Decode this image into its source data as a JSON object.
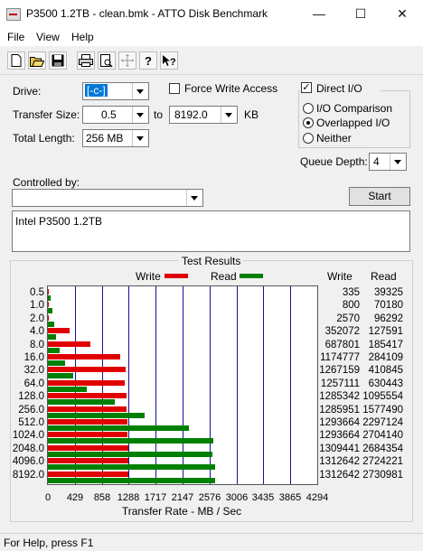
{
  "window": {
    "title": "P3500 1.2TB - clean.bmk - ATTO Disk Benchmark",
    "minimize": "—",
    "maximize": "☐",
    "close": "✕"
  },
  "menu": {
    "file": "File",
    "view": "View",
    "help": "Help"
  },
  "toolbar": {
    "buttons": [
      "new-icon",
      "open-icon",
      "save-icon",
      "print-icon",
      "print-preview-icon",
      "move-icon",
      "help-icon",
      "context-help-icon"
    ]
  },
  "settings": {
    "drive_label": "Drive:",
    "drive_value": "[-c-]",
    "force_write_label": "Force Write Access",
    "force_write_checked": false,
    "direct_io_label": "Direct I/O",
    "direct_io_checked": true,
    "transfer_size_label": "Transfer Size:",
    "transfer_from": "0.5",
    "transfer_to_label": "to",
    "transfer_to": "8192.0",
    "transfer_unit": "KB",
    "total_length_label": "Total Length:",
    "total_length": "256 MB",
    "io_comparison_label": "I/O Comparison",
    "overlapped_io_label": "Overlapped I/O",
    "neither_label": "Neither",
    "selected_mode": "Overlapped I/O",
    "queue_depth_label": "Queue Depth:",
    "queue_depth": "4",
    "controlled_by_label": "Controlled by:",
    "controlled_by_value": "",
    "start_label": "Start",
    "description": "Intel P3500 1.2TB"
  },
  "results": {
    "title": "Test Results",
    "write_legend": "Write",
    "read_legend": "Read",
    "write_col": "Write",
    "read_col": "Read",
    "xlabel": "Transfer Rate - MB / Sec",
    "colors": {
      "write": "#e00000",
      "read": "#008000",
      "grid": "#14149b"
    }
  },
  "chart_data": {
    "type": "bar",
    "orientation": "horizontal",
    "xlim": [
      0,
      4294
    ],
    "xticks": [
      "0",
      "429",
      "858",
      "1288",
      "1717",
      "2147",
      "2576",
      "3006",
      "3435",
      "3865",
      "4294"
    ],
    "categories": [
      "0.5",
      "1.0",
      "2.0",
      "4.0",
      "8.0",
      "16.0",
      "32.0",
      "64.0",
      "128.0",
      "256.0",
      "512.0",
      "1024.0",
      "2048.0",
      "4096.0",
      "8192.0"
    ],
    "series": [
      {
        "name": "Write",
        "values": [
          335,
          800,
          2570,
          352072,
          687801,
          1174777,
          1267159,
          1257111,
          1285342,
          1285951,
          1293664,
          1293664,
          1309441,
          1312642,
          1312642
        ]
      },
      {
        "name": "Read",
        "values": [
          39325,
          70180,
          96292,
          127591,
          185417,
          284109,
          410845,
          630443,
          1095554,
          1577490,
          2297124,
          2704140,
          2684354,
          2724221,
          2730981
        ]
      }
    ],
    "value_unit": "KB/s"
  },
  "status": {
    "text": "For Help, press F1"
  }
}
